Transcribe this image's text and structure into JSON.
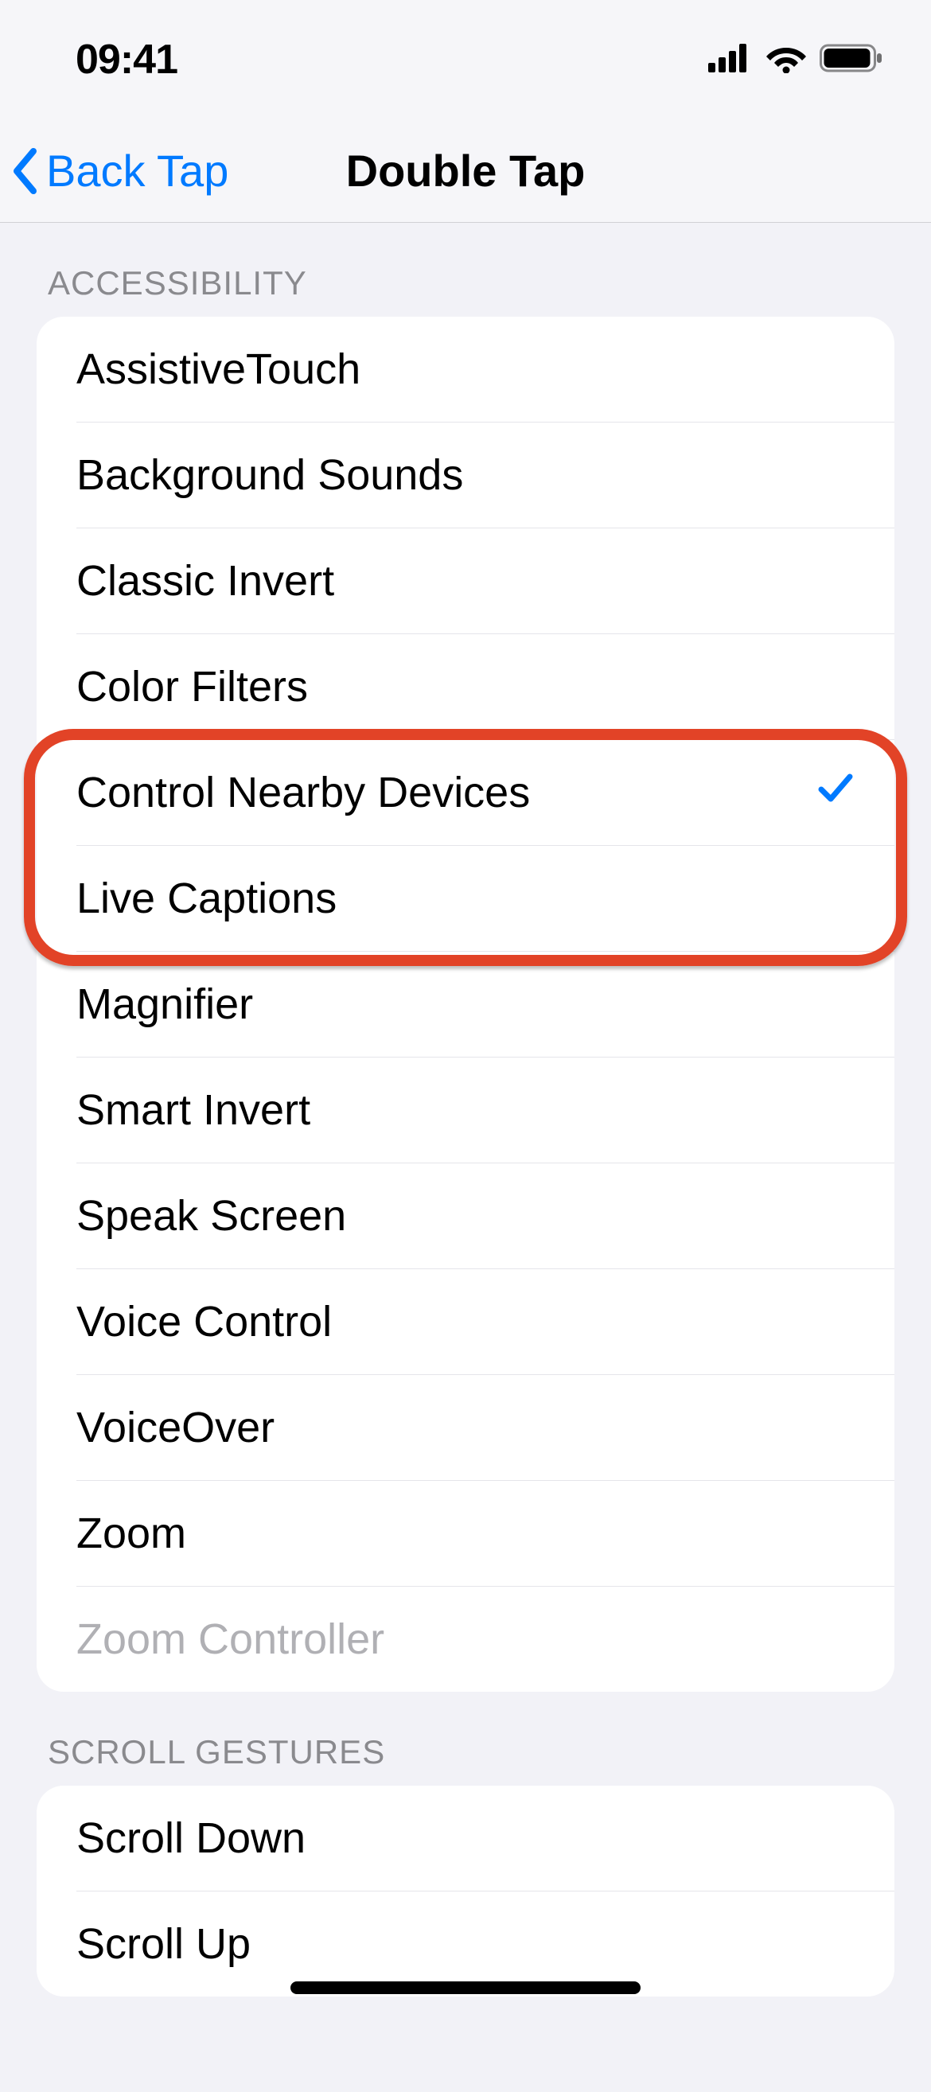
{
  "statusbar": {
    "time": "09:41"
  },
  "nav": {
    "back_label": "Back Tap",
    "title": "Double Tap"
  },
  "sections": {
    "accessibility": {
      "header": "ACCESSIBILITY",
      "items": {
        "assistivetouch": "AssistiveTouch",
        "background_sounds": "Background Sounds",
        "classic_invert": "Classic Invert",
        "color_filters": "Color Filters",
        "control_nearby_devices": "Control Nearby Devices",
        "live_captions": "Live Captions",
        "magnifier": "Magnifier",
        "smart_invert": "Smart Invert",
        "speak_screen": "Speak Screen",
        "voice_control": "Voice Control",
        "voiceover": "VoiceOver",
        "zoom": "Zoom",
        "zoom_controller": "Zoom Controller"
      },
      "selected": "control_nearby_devices"
    },
    "scroll_gestures": {
      "header": "SCROLL GESTURES",
      "items": {
        "scroll_down": "Scroll Down",
        "scroll_up": "Scroll Up"
      }
    }
  },
  "highlight": {
    "items": [
      "control_nearby_devices",
      "live_captions"
    ]
  }
}
